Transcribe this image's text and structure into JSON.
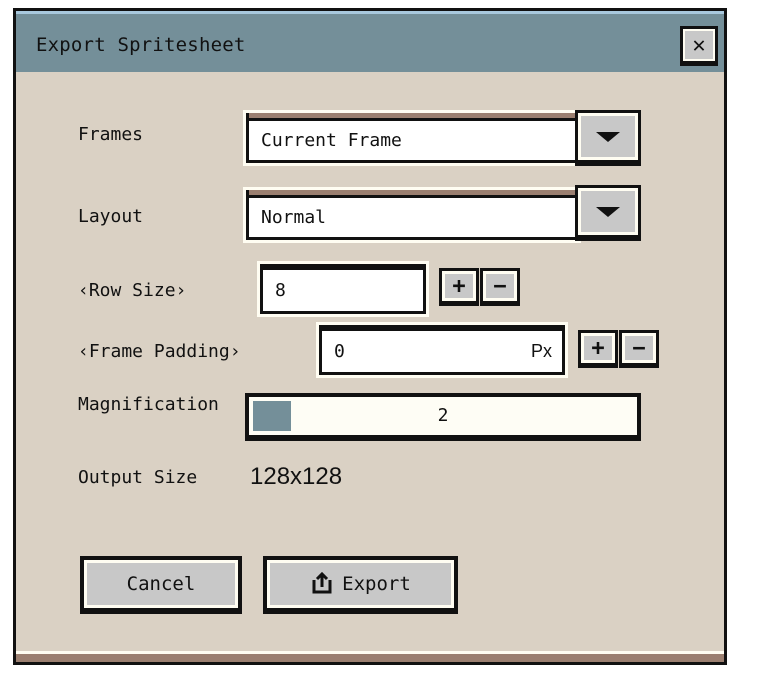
{
  "dialog": {
    "title": "Export Spritesheet",
    "close_icon": "close-icon",
    "close_glyph": "✕"
  },
  "frames": {
    "label": "Frames",
    "value": "Current Frame"
  },
  "layout": {
    "label": "Layout",
    "value": "Normal"
  },
  "row_size": {
    "label": "‹Row Size›",
    "value": "8",
    "plus": "+",
    "minus": "−"
  },
  "frame_padding": {
    "label": "‹Frame Padding›",
    "value": "0",
    "unit": "Px",
    "plus": "+",
    "minus": "−"
  },
  "magnification": {
    "label": "Magnification",
    "value": "2",
    "fill_fraction": 0.1
  },
  "output_size": {
    "label": "Output Size",
    "value": "128x128"
  },
  "buttons": {
    "cancel": "Cancel",
    "export": "Export"
  },
  "colors": {
    "titlebar": "#748f99",
    "body": "#dad1c4",
    "button": "#c8c8c8"
  }
}
